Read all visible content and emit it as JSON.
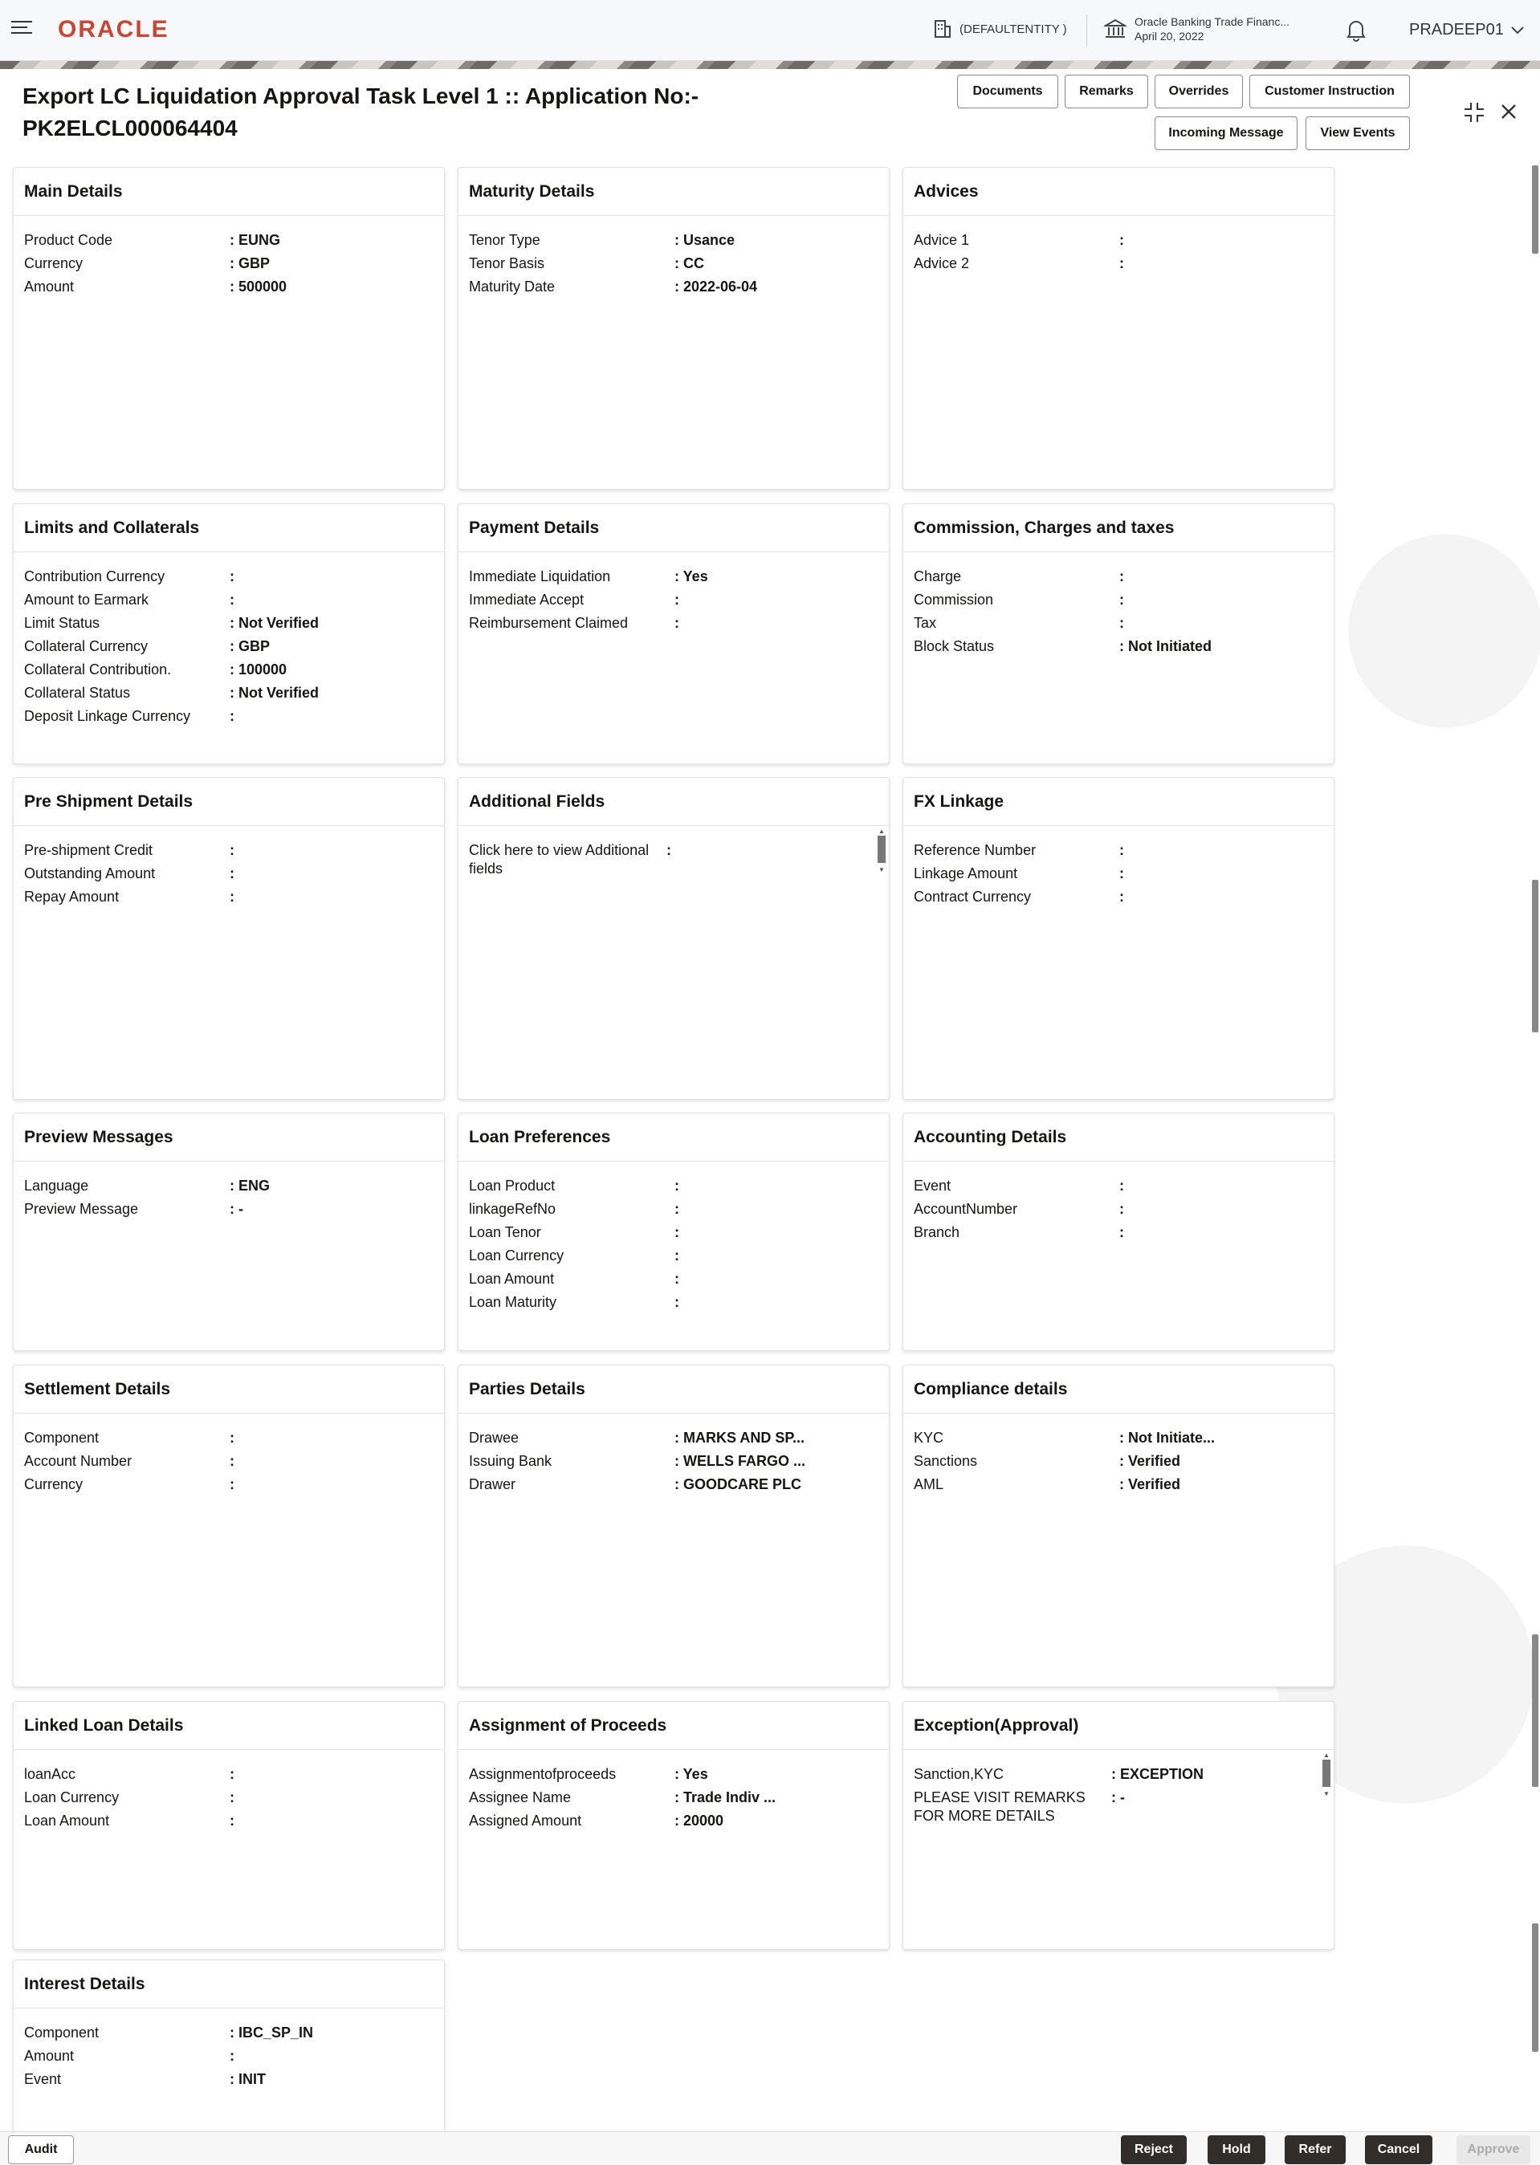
{
  "header": {
    "logo": "ORACLE",
    "entity": "(DEFAULTENTITY )",
    "bank_name": "Oracle Banking Trade Financ...",
    "bank_date": "April 20, 2022",
    "user": "PRADEEP01"
  },
  "page": {
    "title_line1": "Export LC Liquidation Approval Task Level 1 :: Application No:-",
    "title_line2": "PK2ELCL000064404"
  },
  "toolbar": {
    "documents": "Documents",
    "remarks": "Remarks",
    "overrides": "Overrides",
    "customer_instruction": "Customer Instruction",
    "incoming_message": "Incoming Message",
    "view_events": "View Events"
  },
  "cards": {
    "main_details": {
      "title": "Main Details",
      "rows": [
        {
          "label": "Product Code",
          "value": ": EUNG"
        },
        {
          "label": "Currency",
          "value": ": GBP"
        },
        {
          "label": "Amount",
          "value": ": 500000"
        }
      ]
    },
    "maturity_details": {
      "title": "Maturity Details",
      "rows": [
        {
          "label": "Tenor Type",
          "value": ": Usance"
        },
        {
          "label": "Tenor Basis",
          "value": ": CC"
        },
        {
          "label": "Maturity Date",
          "value": ": 2022-06-04"
        }
      ]
    },
    "advices": {
      "title": "Advices",
      "rows": [
        {
          "label": "Advice 1",
          "value": ":"
        },
        {
          "label": "Advice 2",
          "value": ":"
        }
      ]
    },
    "limits": {
      "title": "Limits and Collaterals",
      "rows": [
        {
          "label": "Contribution Currency",
          "value": ":"
        },
        {
          "label": "Amount to Earmark",
          "value": ":"
        },
        {
          "label": "Limit Status",
          "value": ": Not Verified"
        },
        {
          "label": "Collateral Currency",
          "value": ": GBP"
        },
        {
          "label": "Collateral Contribution.",
          "value": ": 100000"
        },
        {
          "label": "Collateral Status",
          "value": ": Not Verified"
        },
        {
          "label": "Deposit Linkage Currency",
          "value": ":"
        }
      ]
    },
    "payment": {
      "title": "Payment Details",
      "rows": [
        {
          "label": "Immediate Liquidation",
          "value": ": Yes"
        },
        {
          "label": "Immediate Accept",
          "value": ":"
        },
        {
          "label": "Reimbursement Claimed",
          "value": ":"
        }
      ]
    },
    "commission": {
      "title": "Commission, Charges and taxes",
      "rows": [
        {
          "label": "Charge",
          "value": ":"
        },
        {
          "label": "Commission",
          "value": ":"
        },
        {
          "label": "Tax",
          "value": ":"
        },
        {
          "label": "Block Status",
          "value": ": Not Initiated"
        }
      ]
    },
    "preshipment": {
      "title": "Pre Shipment Details",
      "rows": [
        {
          "label": "Pre-shipment Credit",
          "value": ":"
        },
        {
          "label": "Outstanding Amount",
          "value": ":"
        },
        {
          "label": "Repay Amount",
          "value": ":"
        }
      ]
    },
    "additional": {
      "title": "Additional Fields",
      "label1": "Click here to view Additional",
      "label2": "fields",
      "value": ":"
    },
    "fx": {
      "title": "FX Linkage",
      "rows": [
        {
          "label": "Reference Number",
          "value": ":"
        },
        {
          "label": "Linkage Amount",
          "value": ":"
        },
        {
          "label": "Contract Currency",
          "value": ":"
        }
      ]
    },
    "preview": {
      "title": "Preview Messages",
      "rows": [
        {
          "label": "Language",
          "value": ": ENG"
        },
        {
          "label": "Preview Message",
          "value": ": -"
        }
      ]
    },
    "loan_pref": {
      "title": "Loan Preferences",
      "rows": [
        {
          "label": "Loan Product",
          "value": ":"
        },
        {
          "label": "linkageRefNo",
          "value": ":"
        },
        {
          "label": "Loan Tenor",
          "value": ":"
        },
        {
          "label": "Loan Currency",
          "value": ":"
        },
        {
          "label": "Loan Amount",
          "value": ":"
        },
        {
          "label": "Loan Maturity",
          "value": ":"
        }
      ]
    },
    "accounting": {
      "title": "Accounting Details",
      "rows": [
        {
          "label": "Event",
          "value": ":"
        },
        {
          "label": "AccountNumber",
          "value": ":"
        },
        {
          "label": "Branch",
          "value": ":"
        }
      ]
    },
    "settlement": {
      "title": "Settlement Details",
      "rows": [
        {
          "label": "Component",
          "value": ":"
        },
        {
          "label": "Account Number",
          "value": ":"
        },
        {
          "label": "Currency",
          "value": ":"
        }
      ]
    },
    "parties": {
      "title": "Parties Details",
      "rows": [
        {
          "label": "Drawee",
          "value": ": MARKS AND SP..."
        },
        {
          "label": "Issuing Bank",
          "value": ": WELLS FARGO ..."
        },
        {
          "label": "Drawer",
          "value": ": GOODCARE PLC"
        }
      ]
    },
    "compliance": {
      "title": "Compliance details",
      "rows": [
        {
          "label": "KYC",
          "value": ": Not Initiate..."
        },
        {
          "label": "Sanctions",
          "value": ": Verified"
        },
        {
          "label": "AML",
          "value": ": Verified"
        }
      ]
    },
    "linked_loan": {
      "title": "Linked Loan Details",
      "rows": [
        {
          "label": "loanAcc",
          "value": ":"
        },
        {
          "label": "Loan Currency",
          "value": ":"
        },
        {
          "label": "Loan Amount",
          "value": ":"
        }
      ]
    },
    "assignment": {
      "title": "Assignment of Proceeds",
      "rows": [
        {
          "label": "Assignmentofproceeds",
          "value": ": Yes"
        },
        {
          "label": "Assignee Name",
          "value": ": Trade Indiv ..."
        },
        {
          "label": "Assigned Amount",
          "value": ": 20000"
        }
      ]
    },
    "exception": {
      "title": "Exception(Approval)",
      "row1_label": "Sanction,KYC",
      "row1_value": ": EXCEPTION",
      "row2_label1": "PLEASE VISIT REMARKS",
      "row2_label2": "FOR MORE DETAILS",
      "row2_value": ": -"
    },
    "interest": {
      "title": "Interest Details",
      "rows": [
        {
          "label": "Component",
          "value": ": IBC_SP_IN"
        },
        {
          "label": "Amount",
          "value": ":"
        },
        {
          "label": "Event",
          "value": ": INIT"
        }
      ]
    }
  },
  "footer": {
    "audit": "Audit",
    "reject": "Reject",
    "hold": "Hold",
    "refer": "Refer",
    "cancel": "Cancel",
    "approve": "Approve"
  },
  "colors": {
    "brand": "#c74634",
    "dark_button": "#312d2a"
  }
}
